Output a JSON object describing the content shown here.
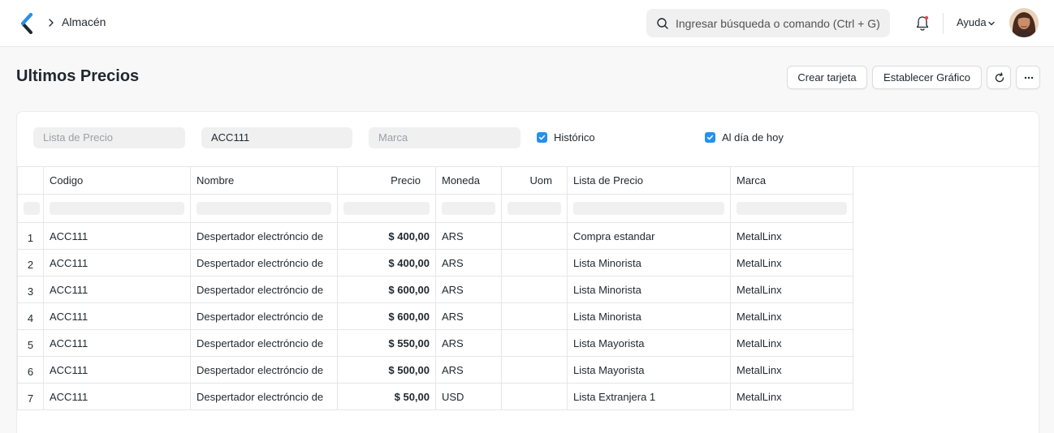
{
  "navbar": {
    "breadcrumb": "Almacén",
    "search_placeholder": "Ingresar búsqueda o comando (Ctrl + G)",
    "help_label": "Ayuda",
    "icons": [
      "logo-chevron-icon",
      "chevron-right-icon",
      "search-icon",
      "bell-icon",
      "chevron-down-icon"
    ]
  },
  "page": {
    "title": "Ultimos Precios",
    "buttons": {
      "crear": "Crear tarjeta",
      "grafico": "Establecer Gráfico"
    }
  },
  "filters": {
    "lista_placeholder": "Lista de Precio",
    "codigo_value": "ACC111",
    "marca_placeholder": "Marca",
    "historico_label": "Histórico",
    "historico_checked": true,
    "aldia_label": "Al día de hoy",
    "aldia_checked": true
  },
  "table": {
    "columns": [
      "",
      "Codigo",
      "Nombre",
      "Precio",
      "Moneda",
      "Uom",
      "Lista de Precio",
      "Marca"
    ],
    "rows": [
      {
        "idx": "1",
        "codigo": "ACC111",
        "nombre": "Despertador electróncio de",
        "precio": "$ 400,00",
        "moneda": "ARS",
        "uom": "",
        "lista": "Compra estandar",
        "marca": "MetalLinx"
      },
      {
        "idx": "2",
        "codigo": "ACC111",
        "nombre": "Despertador electróncio de",
        "precio": "$ 400,00",
        "moneda": "ARS",
        "uom": "",
        "lista": "Lista Minorista",
        "marca": "MetalLinx"
      },
      {
        "idx": "3",
        "codigo": "ACC111",
        "nombre": "Despertador electróncio de",
        "precio": "$ 600,00",
        "moneda": "ARS",
        "uom": "",
        "lista": "Lista Minorista",
        "marca": "MetalLinx"
      },
      {
        "idx": "4",
        "codigo": "ACC111",
        "nombre": "Despertador electróncio de",
        "precio": "$ 600,00",
        "moneda": "ARS",
        "uom": "",
        "lista": "Lista Minorista",
        "marca": "MetalLinx"
      },
      {
        "idx": "5",
        "codigo": "ACC111",
        "nombre": "Despertador electróncio de",
        "precio": "$ 550,00",
        "moneda": "ARS",
        "uom": "",
        "lista": "Lista Mayorista",
        "marca": "MetalLinx"
      },
      {
        "idx": "6",
        "codigo": "ACC111",
        "nombre": "Despertador electróncio de",
        "precio": "$ 500,00",
        "moneda": "ARS",
        "uom": "",
        "lista": "Lista Mayorista",
        "marca": "MetalLinx"
      },
      {
        "idx": "7",
        "codigo": "ACC111",
        "nombre": "Despertador electróncio de",
        "precio": "$ 50,00",
        "moneda": "USD",
        "uom": "",
        "lista": "Lista Extranjera 1",
        "marca": "MetalLinx"
      }
    ]
  },
  "colors": {
    "accent": "#2490ef",
    "text": "#1f272e",
    "placeholder": "#9aa0a6",
    "field_bg": "#f0f0f0"
  }
}
